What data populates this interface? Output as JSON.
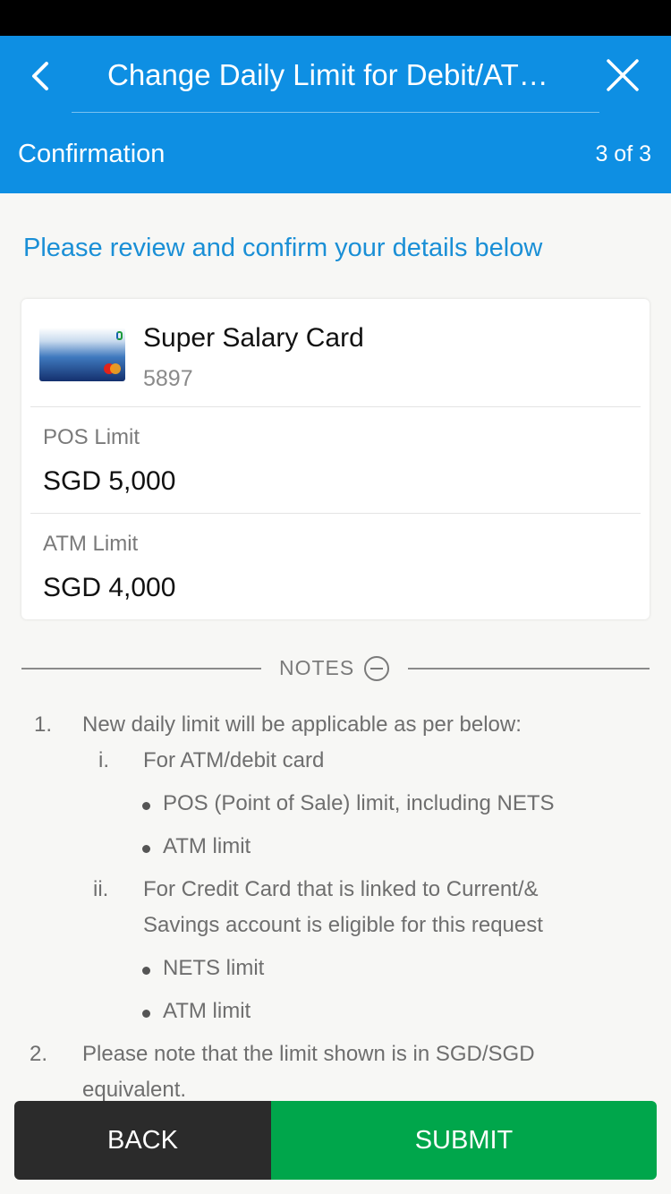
{
  "header": {
    "title": "Change Daily Limit for Debit/ATM Card",
    "step_label": "Confirmation",
    "step_count": "3 of 3"
  },
  "review_heading": "Please review and confirm your details below",
  "card": {
    "name": "Super Salary Card",
    "number": "5897",
    "limits": [
      {
        "label": "POS Limit",
        "value": "SGD 5,000"
      },
      {
        "label": "ATM Limit",
        "value": "SGD 4,000"
      }
    ]
  },
  "notes": {
    "label": "NOTES",
    "items": [
      {
        "num": "1.",
        "text": "New daily limit will be applicable as per below:"
      },
      {
        "num": "i.",
        "text": "For ATM/debit card"
      },
      {
        "bullet": "POS (Point of Sale) limit, including NETS"
      },
      {
        "bullet": "ATM limit"
      },
      {
        "num": "ii.",
        "text": "For Credit Card that is linked to Current/&"
      },
      {
        "text": "Savings account is eligible for this request"
      },
      {
        "bullet": "NETS limit"
      },
      {
        "bullet": "ATM limit"
      },
      {
        "num": "2.",
        "text": "Please note that the limit shown is in SGD/SGD"
      },
      {
        "text": "equivalent."
      }
    ]
  },
  "buttons": {
    "back": "BACK",
    "submit": "SUBMIT"
  },
  "colors": {
    "header_bg": "#0e8fe3",
    "heading_accent": "#1a8fd6",
    "submit_bg": "#00a64b",
    "back_bg": "#2b2b2b"
  },
  "icons": [
    "chevron-left-icon",
    "close-icon",
    "minus-circle-icon",
    "card-thumbnail"
  ]
}
